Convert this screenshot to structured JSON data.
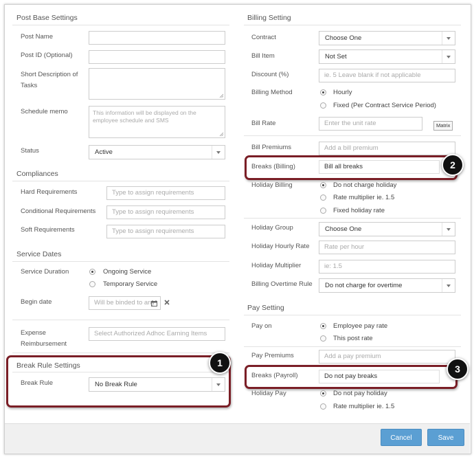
{
  "post_base": {
    "title": "Post Base Settings",
    "post_name_label": "Post Name",
    "post_name_value": "",
    "post_id_label": "Post ID (Optional)",
    "post_id_value": "",
    "short_desc_label_1": "Short Description of",
    "short_desc_label_2": "Tasks",
    "schedule_memo_label": "Schedule memo",
    "schedule_memo_placeholder": "This information will be displayed on the employee schedule and SMS",
    "status_label": "Status",
    "status_value": "Active"
  },
  "compliances": {
    "title": "Compliances",
    "hard_label": "Hard Requirements",
    "conditional_label": "Conditional Requirements",
    "soft_label": "Soft Requirements",
    "placeholder": "Type to assign requirements"
  },
  "service_dates": {
    "title": "Service Dates",
    "duration_label": "Service Duration",
    "ongoing": "Ongoing Service",
    "temporary": "Temporary Service",
    "begin_label": "Begin date",
    "begin_placeholder": "Will be binded to any"
  },
  "expense": {
    "label_1": "Expense",
    "label_2": "Reimbursement",
    "placeholder": "Select Authorized Adhoc Earning Items"
  },
  "break_rule": {
    "title": "Break Rule Settings",
    "label": "Break Rule",
    "value": "No Break Rule"
  },
  "billing": {
    "title": "Billing Setting",
    "contract_label": "Contract",
    "contract_value": "Choose One",
    "bill_item_label": "Bill Item",
    "bill_item_value": "Not Set",
    "discount_label": "Discount (%)",
    "discount_placeholder": "ie. 5  Leave blank if not applicable",
    "method_label": "Billing Method",
    "method_hourly": "Hourly",
    "method_fixed": "Fixed (Per Contract Service Period)",
    "bill_rate_label": "Bill Rate",
    "bill_rate_placeholder": "Enter the unit rate",
    "matrix_label": "Matrix",
    "premiums_label": "Bill Premiums",
    "premiums_placeholder": "Add a bill premium",
    "breaks_label": "Breaks (Billing)",
    "breaks_value": "Bill all breaks",
    "holiday_billing_label": "Holiday Billing",
    "holiday_opt1": "Do not charge holiday",
    "holiday_opt2": "Rate multiplier ie. 1.5",
    "holiday_opt3": "Fixed holiday rate",
    "holiday_group_label": "Holiday Group",
    "holiday_group_value": "Choose One",
    "holiday_hourly_label": "Holiday Hourly Rate",
    "holiday_hourly_placeholder": "Rate per hour",
    "holiday_mult_label": "Holiday Multiplier",
    "holiday_mult_placeholder": "ie: 1.5",
    "overtime_label": "Billing Overtime Rule",
    "overtime_value": "Do not charge for overtime"
  },
  "pay": {
    "title": "Pay Setting",
    "pay_on_label": "Pay on",
    "pay_on_opt1": "Employee pay rate",
    "pay_on_opt2": "This post rate",
    "premiums_label": "Pay Premiums",
    "premiums_placeholder": "Add a pay premium",
    "breaks_label": "Breaks (Payroll)",
    "breaks_value": "Do not pay breaks",
    "holiday_pay_label": "Holiday Pay",
    "holiday_opt1": "Do not pay holiday",
    "holiday_opt2": "Rate multiplier ie. 1.5"
  },
  "badges": {
    "b1": "1",
    "b2": "2",
    "b3": "3"
  },
  "footer": {
    "cancel": "Cancel",
    "save": "Save"
  },
  "colors": {
    "highlight": "#7a1e26",
    "button": "#5b9fd3",
    "badge": "#111111"
  }
}
